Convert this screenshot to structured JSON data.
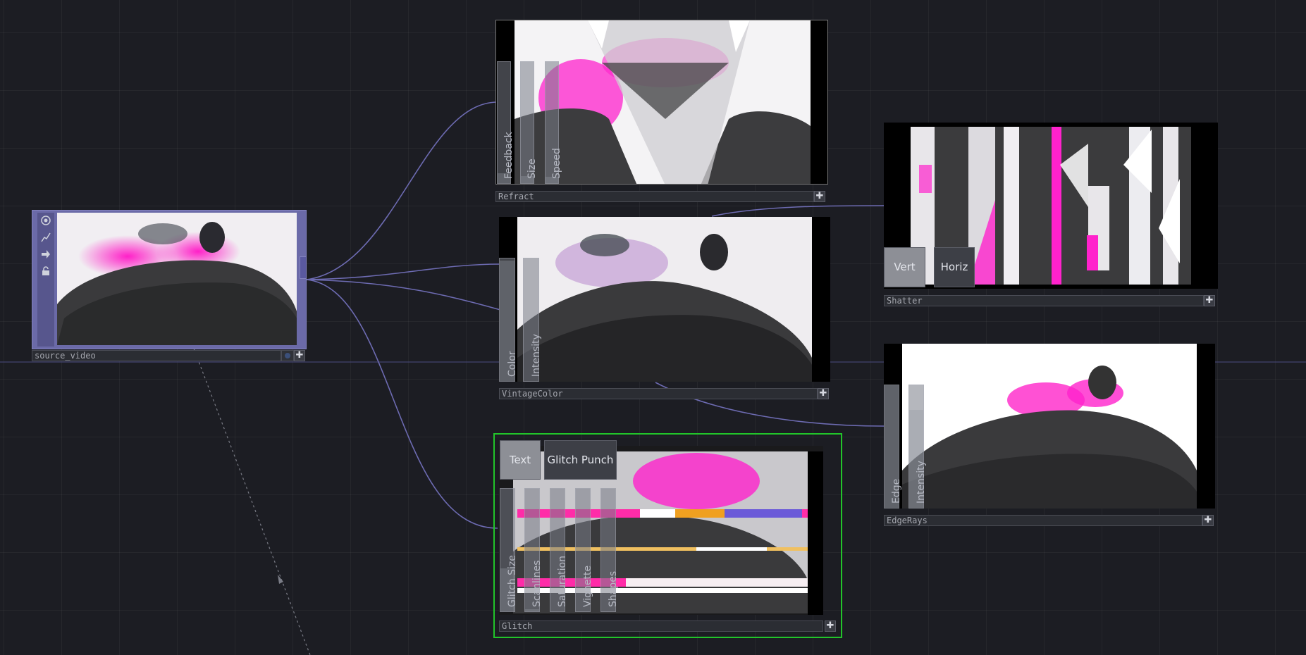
{
  "nodes": {
    "source_video": {
      "label": "source_video"
    },
    "refract": {
      "label": "Refract",
      "sliders": [
        {
          "label": "Feedback",
          "value": 0.08
        },
        {
          "label": "Size",
          "value": 0.06
        },
        {
          "label": "Speed",
          "value": 0.05
        }
      ]
    },
    "vintagecolor": {
      "label": "VintageColor",
      "sliders": [
        {
          "label": "Color",
          "value": 0.98
        },
        {
          "label": "Intensity",
          "value": 0.0
        }
      ]
    },
    "glitch": {
      "label": "Glitch",
      "buttons": [
        {
          "label": "Text",
          "active": true
        },
        {
          "label": "Glitch Punch",
          "active": false
        }
      ],
      "sliders": [
        {
          "label": "Glitch Size",
          "value": 0.35
        },
        {
          "label": "Scanlines",
          "value": 0.02
        },
        {
          "label": "Saturation",
          "value": 0.0
        },
        {
          "label": "Vignette",
          "value": 0.0
        },
        {
          "label": "Shapes",
          "value": 0.0
        }
      ]
    },
    "shatter": {
      "label": "Shatter",
      "buttons": [
        {
          "label": "Vert",
          "active": true
        },
        {
          "label": "Horiz",
          "active": false
        }
      ]
    },
    "edgerays": {
      "label": "EdgeRays",
      "sliders": [
        {
          "label": "Edge",
          "value": 1.0
        },
        {
          "label": "Intensity",
          "value": 0.8
        }
      ]
    }
  },
  "plus_symbol": "✚",
  "colors": {
    "wire": "#7d7ac8",
    "selected_border": "#22c42a",
    "background": "#1c1d23",
    "accent_purple": "#6d6bb2"
  }
}
